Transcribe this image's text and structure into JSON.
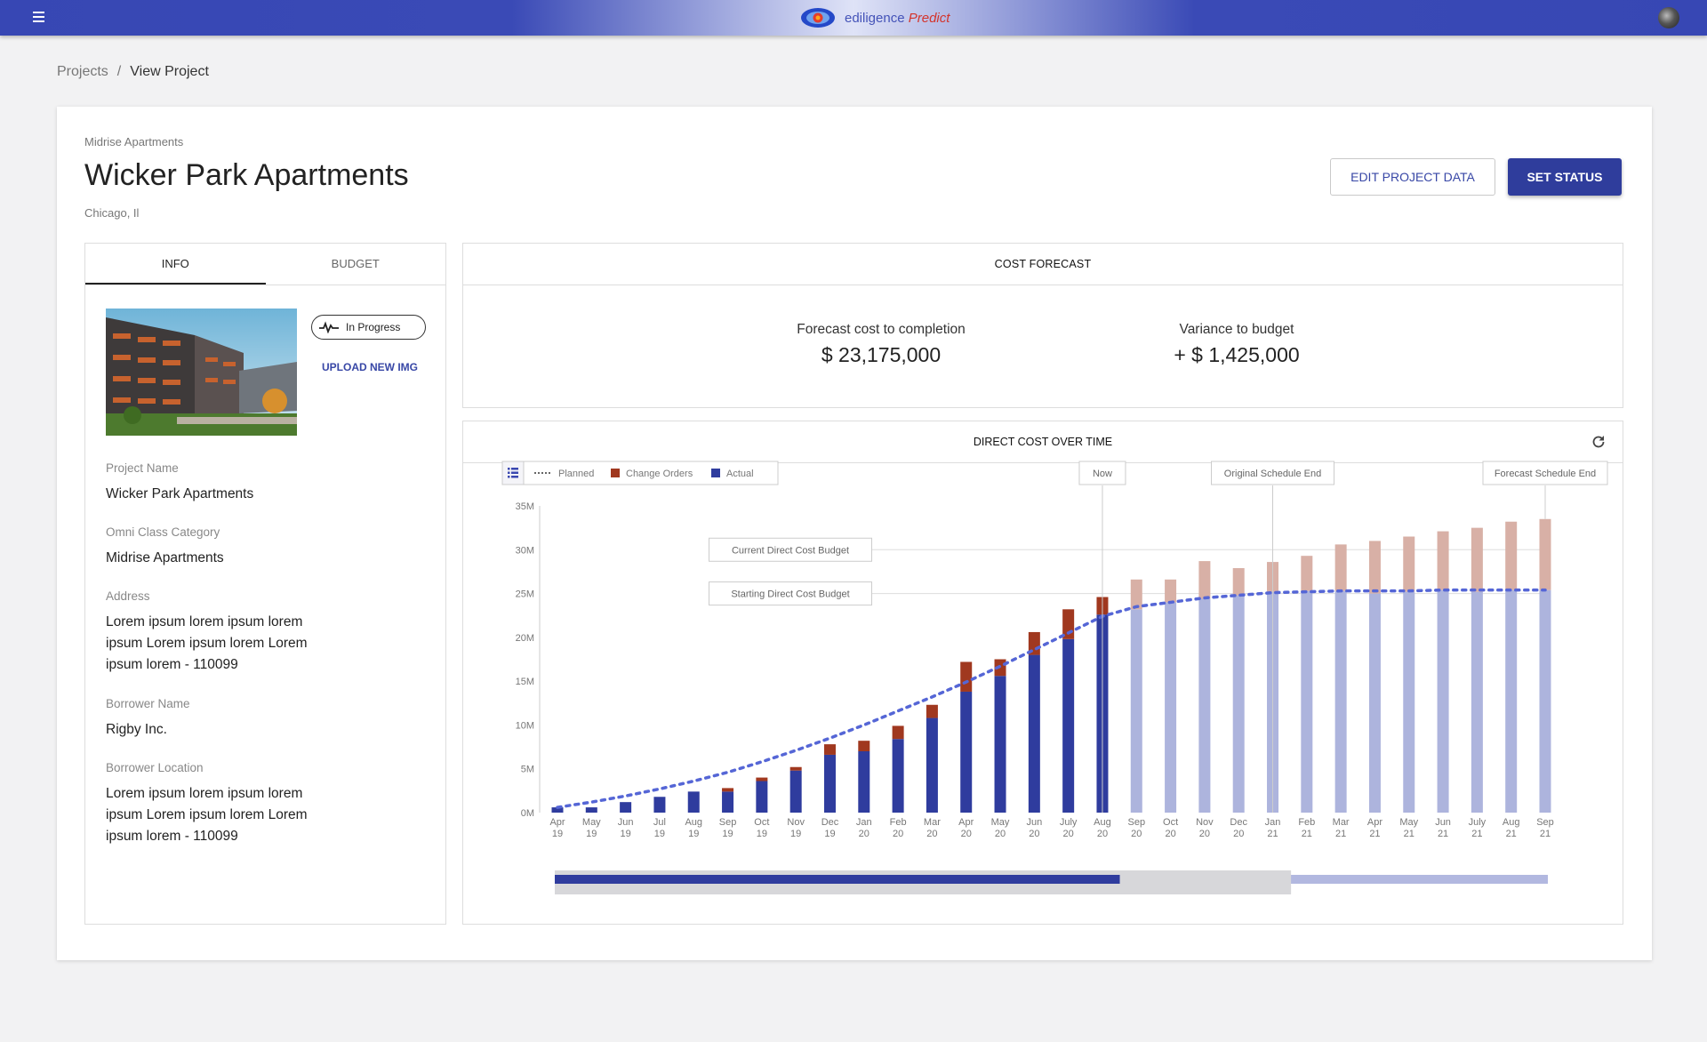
{
  "app": {
    "brand": "ediligence",
    "brand_accent": "Predict"
  },
  "breadcrumb": {
    "parent": "Projects",
    "separator": "/",
    "current": "View Project"
  },
  "project": {
    "category_label": "Midrise Apartments",
    "title": "Wicker Park Apartments",
    "location": "Chicago, Il"
  },
  "actions": {
    "edit": "EDIT PROJECT DATA",
    "status": "SET STATUS"
  },
  "left": {
    "tabs": [
      {
        "label": "INFO"
      },
      {
        "label": "BUDGET"
      }
    ],
    "status": "In Progress",
    "upload": "UPLOAD NEW IMG",
    "fields": [
      {
        "label": "Project Name",
        "value": "Wicker Park Apartments"
      },
      {
        "label": "Omni Class Category",
        "value": "Midrise Apartments"
      },
      {
        "label": "Address",
        "value": "Lorem ipsum lorem ipsum lorem ipsum Lorem ipsum lorem Lorem ipsum lorem - 110099"
      },
      {
        "label": "Borrower Name",
        "value": "Rigby Inc."
      },
      {
        "label": "Borrower Location",
        "value": "Lorem ipsum lorem ipsum lorem ipsum Lorem ipsum lorem Lorem ipsum lorem - 110099"
      }
    ]
  },
  "forecast": {
    "heading": "COST FORECAST",
    "completion_label": "Forecast cost to completion",
    "completion_value": "$ 23,175,000",
    "variance_label": "Variance to budget",
    "variance_value": "+ $ 1,425,000"
  },
  "direct_cost": {
    "heading": "DIRECT COST OVER TIME"
  },
  "colors": {
    "actual": "#2f3c9e",
    "change_orders": "#a0381f",
    "planned": "#5566d6",
    "forecast_actual": "#adb4dd",
    "forecast_change": "#d8b0a6",
    "accent": "#3747b4"
  },
  "chart_data": {
    "type": "bar",
    "stacked": true,
    "categories": [
      "Apr 19",
      "May 19",
      "Jun 19",
      "Jul 19",
      "Aug 19",
      "Sep 19",
      "Oct 19",
      "Nov 19",
      "Dec 19",
      "Jan 20",
      "Feb 20",
      "Mar 20",
      "Apr 20",
      "May 20",
      "Jun 20",
      "July 20",
      "Aug 20",
      "Sep 20",
      "Oct 20",
      "Nov 20",
      "Dec 20",
      "Jan 21",
      "Feb 21",
      "Mar 21",
      "Apr 21",
      "May 21",
      "Jun 21",
      "July 21",
      "Aug 21",
      "Sep 21"
    ],
    "series": [
      {
        "name": "Actual",
        "values": [
          0.6,
          0.6,
          1.2,
          1.8,
          2.4,
          2.4,
          3.6,
          4.8,
          6.6,
          7.0,
          8.4,
          10.8,
          13.8,
          15.6,
          18.0,
          19.8,
          22.6,
          23.2,
          24.0,
          24.4,
          24.8,
          25.2,
          25.3,
          25.3,
          25.0,
          25.2,
          25.4,
          25.2,
          25.4,
          25.4
        ]
      },
      {
        "name": "Change Orders",
        "values": [
          0,
          0,
          0,
          0,
          0,
          0.4,
          0.4,
          0.4,
          1.2,
          1.2,
          1.5,
          1.5,
          3.4,
          1.9,
          2.6,
          3.4,
          2.0,
          3.4,
          2.6,
          4.3,
          3.1,
          3.4,
          4.0,
          5.3,
          6.0,
          6.3,
          6.7,
          7.3,
          7.8,
          8.1
        ]
      },
      {
        "name": "Planned",
        "values": [
          0.6,
          1.2,
          1.9,
          2.7,
          3.6,
          4.6,
          5.8,
          7.1,
          8.5,
          10.0,
          11.6,
          13.2,
          14.9,
          16.7,
          18.6,
          20.5,
          22.4,
          23.5,
          24.0,
          24.5,
          24.8,
          25.1,
          25.2,
          25.3,
          25.3,
          25.3,
          25.4,
          25.4,
          25.4,
          25.4
        ]
      }
    ],
    "forecast_start_index": 17,
    "ylim": [
      0,
      35
    ],
    "yticks": [
      "0M",
      "5M",
      "10M",
      "15M",
      "20M",
      "25M",
      "30M",
      "35M"
    ],
    "legend": [
      "Planned",
      "Change Orders",
      "Actual"
    ],
    "annotations": {
      "now": "Now",
      "original_end": "Original Schedule End",
      "forecast_end": "Forecast Schedule End",
      "current_budget": "Current Direct Cost Budget",
      "starting_budget": "Starting Direct Cost Budget"
    }
  }
}
